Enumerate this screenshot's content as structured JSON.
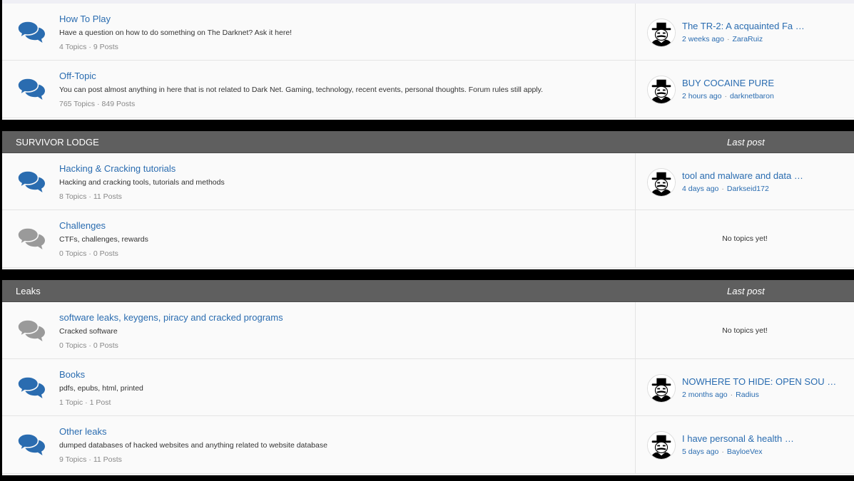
{
  "icons": {
    "forum_unread": "comments-icon",
    "forum_read": "comments-icon",
    "avatar": "user-avatar"
  },
  "colors": {
    "unread_icon": "#2a6cb0",
    "read_icon": "#9a9a9a",
    "link": "#2a6cb0",
    "header_bg": "#5f5f5f"
  },
  "categories": [
    {
      "title": "",
      "last_post_label": "",
      "forums": [
        {
          "title": "How To Play",
          "desc": "Have a question on how to do something on The Darknet? Ask it here!",
          "topics": "4 Topics",
          "posts": "9 Posts",
          "last_title": "The TR-2: A acquainted Fa …",
          "last_time": "2 weeks ago",
          "last_author": "ZaraRuiz"
        },
        {
          "title": "Off-Topic",
          "desc": "You can post almost anything in here that is not related to Dark Net. Gaming, technology, recent events, personal thoughts. Forum rules still apply.",
          "topics": "765 Topics",
          "posts": "849 Posts",
          "last_title": "BUY COCAINE PURE",
          "last_time": "2 hours ago",
          "last_author": "darknetbaron"
        }
      ]
    },
    {
      "title": "SURVIVOR LODGE",
      "last_post_label": "Last post",
      "forums": [
        {
          "title": "Hacking & Cracking tutorials",
          "desc": "Hacking and cracking tools, tutorials and methods",
          "topics": "8 Topics",
          "posts": "11 Posts",
          "last_title": "tool and malware and data …",
          "last_time": "4 days ago",
          "last_author": "Darkseid172"
        },
        {
          "title": "Challenges",
          "desc": "CTFs, challenges, rewards",
          "topics": "0 Topics",
          "posts": "0 Posts",
          "no_topics": "No topics yet!"
        }
      ]
    },
    {
      "title": "Leaks",
      "last_post_label": "Last post",
      "forums": [
        {
          "title": "software leaks, keygens, piracy and cracked programs",
          "desc": "Cracked software",
          "topics": "0 Topics",
          "posts": "0 Posts",
          "no_topics": "No topics yet!"
        },
        {
          "title": "Books",
          "desc": "pdfs, epubs, html, printed",
          "topics": "1 Topic",
          "posts": "1 Post",
          "last_title": "NOWHERE TO HIDE: OPEN SOU …",
          "last_time": "2 months ago",
          "last_author": "Radius"
        },
        {
          "title": "Other leaks",
          "desc": "dumped databases of hacked websites and anything related to website database",
          "topics": "9 Topics",
          "posts": "11 Posts",
          "last_title": "I have personal & health …",
          "last_time": "5 days ago",
          "last_author": "BayloeVex"
        }
      ]
    }
  ]
}
